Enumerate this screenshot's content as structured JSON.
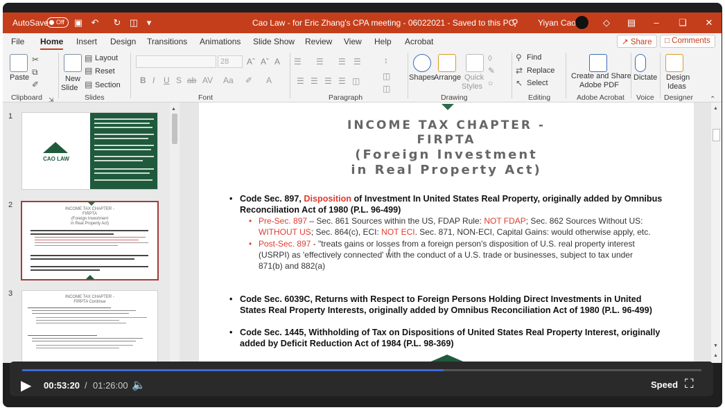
{
  "titlebar": {
    "autosave_label": "AutoSave",
    "autosave_state": "Off",
    "doc_title": "Cao Law - for Eric Zhang's CPA meeting - 06022021 - Saved to this PC",
    "user_name": "Yiyan Cao"
  },
  "tabs": [
    "File",
    "Home",
    "Insert",
    "Design",
    "Transitions",
    "Animations",
    "Slide Show",
    "Review",
    "View",
    "Help",
    "Acrobat"
  ],
  "share_label": "Share",
  "comments_label": "Comments",
  "ribbon": {
    "paste": "Paste",
    "new_slide_1": "New",
    "new_slide_2": "Slide",
    "layout": "Layout",
    "reset": "Reset",
    "section": "Section",
    "font_size": "28",
    "shapes": "Shapes",
    "arrange": "Arrange",
    "quick_styles_1": "Quick",
    "quick_styles_2": "Styles",
    "find": "Find",
    "replace": "Replace",
    "select": "Select",
    "create_share_1": "Create and Share",
    "create_share_2": "Adobe PDF",
    "dictate": "Dictate",
    "design_ideas_1": "Design",
    "design_ideas_2": "Ideas",
    "groups": [
      "Clipboard",
      "Slides",
      "Font",
      "Paragraph",
      "Drawing",
      "Editing",
      "Adobe Acrobat",
      "Voice",
      "Designer"
    ]
  },
  "panel": {
    "slide_numbers": [
      "1",
      "2",
      "3"
    ],
    "thumb1_brand": "CAO LAW",
    "thumb2_title_1": "INCOME TAX CHAPTER -",
    "thumb2_title_2": "FIRPTA",
    "thumb2_title_3": "(Foreign Investment",
    "thumb2_title_4": "in Real Property Act)",
    "thumb3_title_1": "INCOME TAX CHAPTER -",
    "thumb3_title_2": "FIRPTA  Continue"
  },
  "slide": {
    "title_1": "INCOME TAX CHAPTER -",
    "title_2": "FIRPTA",
    "title_3": "(Foreign Investment",
    "title_4": "in Real Property Act)",
    "b1_a": "Code Sec. 897,",
    "b1_red": "Disposition",
    "b1_b": "of Investment In United States Real Property, originally added by Omnibus",
    "b1_line2": "Reconciliation Act of 1980 (P.L. 96-499)",
    "s1_red": "Pre-Sec. 897",
    "s1_a": "– Sec. 861 Sources within the US, FDAP Rule:",
    "s1_red2": "NOT FDAP",
    "s1_b": ";  Sec. 862 Sources Without US:",
    "s1_red3": "WITHOUT US",
    "s1_c": "; Sec. 864(c), ECI:",
    "s1_red4": "NOT ECI",
    "s1_d": ". Sec. 871, NON-ECI, Capital Gains: would otherwise apply, etc.",
    "s2_red": "Post-Sec. 897",
    "s2_a": "- \"treats gains or losses from a foreign person's disposition of U.S. real property interest",
    "s2_line2": "(USRPI) as 'effectively connected' with the conduct of a U.S. trade or businesses, subject to tax under",
    "s2_line3": "871(b) and 882(a)",
    "b2_line1": "Code Sec. 6039C, Returns with Respect to Foreign Persons Holding Direct Investments in United",
    "b2_line2": "States Real Property Interests, originally added by Omnibus Reconciliation Act of 1980 (P.L. 96-499)",
    "b3_line1": "Code Sec. 1445, Withholding of Tax on Dispositions of United States Real Property Interest, originally",
    "b3_line2": "added by Deficit Reduction Act of 1984 (P.L. 98-369)"
  },
  "video": {
    "current_time": "00:53:20",
    "separator": "/",
    "total_time": "01:26:00",
    "progress_fraction": 0.62,
    "speed_label": "Speed"
  },
  "colors": {
    "titlebar": "#c43e1c",
    "accent_red": "#e03a2f",
    "logo_green": "#1f5a3c"
  }
}
